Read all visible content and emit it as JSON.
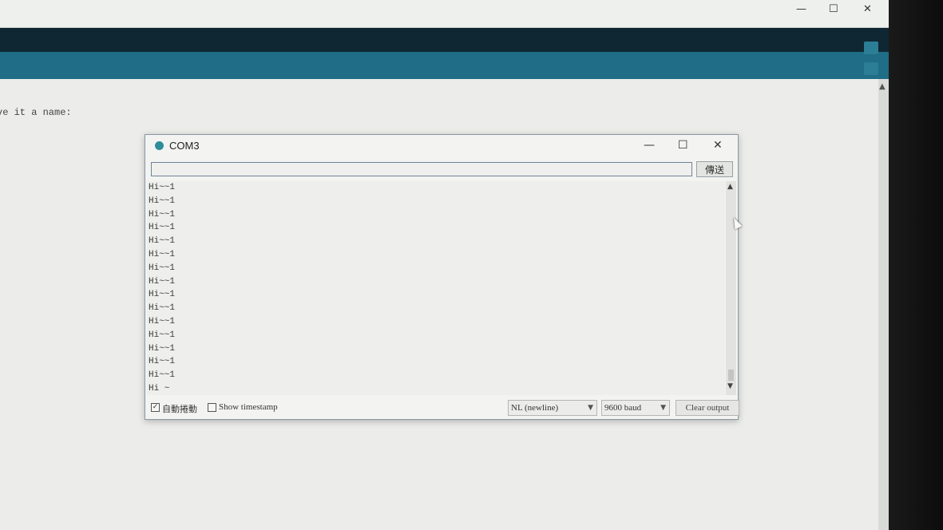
{
  "parent_window": {
    "controls": {
      "minimize": "—",
      "maximize": "☐",
      "close": "✕"
    },
    "editor_text": "ve it a name:"
  },
  "monitor": {
    "title": "COM3",
    "controls": {
      "minimize": "—",
      "maximize": "☐",
      "close": "✕"
    },
    "input_value": "",
    "send_label": "傳送",
    "output_lines": [
      "Hi~~1",
      "Hi~~1",
      "Hi~~1",
      "Hi~~1",
      "Hi~~1",
      "Hi~~1",
      "Hi~~1",
      "Hi~~1",
      "Hi~~1",
      "Hi~~1",
      "Hi~~1",
      "Hi~~1",
      "Hi~~1",
      "Hi~~1",
      "Hi~~1",
      "Hi ~"
    ],
    "autoscroll": {
      "label": "自動捲動",
      "checked": true
    },
    "timestamp": {
      "label": "Show timestamp",
      "checked": false
    },
    "line_ending": "NL (newline)",
    "baud_rate": "9600 baud",
    "clear_label": "Clear output"
  },
  "colors": {
    "toolbar": "#1f6d86",
    "dark_band": "#0f2733",
    "logo": "#2f8c99"
  }
}
